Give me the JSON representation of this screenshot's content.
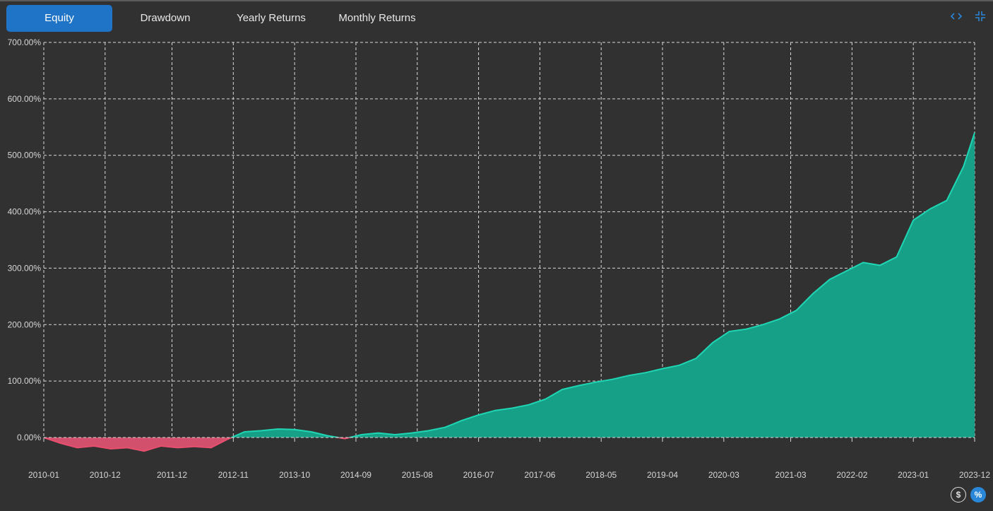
{
  "tabs": [
    {
      "label": "Equity",
      "active": true
    },
    {
      "label": "Drawdown",
      "active": false
    },
    {
      "label": "Yearly Returns",
      "active": false
    },
    {
      "label": "Monthly Returns",
      "active": false
    }
  ],
  "controls": {
    "expand_icon": "code-brackets-icon",
    "collapse_icon": "minimize-icon",
    "dollar_label": "$",
    "percent_label": "%",
    "active_unit": "percent"
  },
  "colors": {
    "background": "#313131",
    "positive": "#17a088",
    "positive_line": "#1fd6b4",
    "negative": "#d2506b",
    "negative_line": "#e84f6f",
    "accent": "#1f74c8",
    "grid": "#d9d9d9"
  },
  "chart_data": {
    "type": "area",
    "title": "",
    "xlabel": "",
    "ylabel": "",
    "grid": true,
    "ylim": [
      -50,
      700
    ],
    "y_ticks": [
      "0.00%",
      "100.00%",
      "200.00%",
      "300.00%",
      "400.00%",
      "500.00%",
      "600.00%",
      "700.00%"
    ],
    "x_ticks": [
      "2010-01",
      "2010-12",
      "2011-12",
      "2012-11",
      "2013-10",
      "2014-09",
      "2015-08",
      "2016-07",
      "2017-06",
      "2018-05",
      "2019-04",
      "2020-03",
      "2021-03",
      "2022-02",
      "2023-01",
      "2023-12"
    ],
    "series": [
      {
        "name": "",
        "x": [
          "2010-01",
          "2010-04",
          "2010-07",
          "2010-10",
          "2011-01",
          "2011-04",
          "2011-07",
          "2011-10",
          "2012-01",
          "2012-04",
          "2012-07",
          "2012-10",
          "2013-01",
          "2013-04",
          "2013-07",
          "2013-10",
          "2014-01",
          "2014-04",
          "2014-07",
          "2014-10",
          "2015-01",
          "2015-04",
          "2015-07",
          "2015-10",
          "2016-01",
          "2016-04",
          "2016-07",
          "2016-10",
          "2017-01",
          "2017-04",
          "2017-07",
          "2017-10",
          "2018-01",
          "2018-04",
          "2018-07",
          "2018-10",
          "2019-01",
          "2019-04",
          "2019-07",
          "2019-10",
          "2020-01",
          "2020-04",
          "2020-07",
          "2020-10",
          "2021-01",
          "2021-04",
          "2021-07",
          "2021-10",
          "2022-01",
          "2022-04",
          "2022-07",
          "2022-10",
          "2023-01",
          "2023-04",
          "2023-07",
          "2023-10",
          "2023-12"
        ],
        "values": [
          0,
          -10,
          -18,
          -15,
          -20,
          -18,
          -24,
          -15,
          -18,
          -16,
          -18,
          -3,
          10,
          12,
          15,
          14,
          10,
          3,
          -2,
          5,
          8,
          5,
          8,
          12,
          18,
          30,
          40,
          48,
          52,
          58,
          68,
          85,
          92,
          98,
          103,
          110,
          115,
          122,
          128,
          140,
          168,
          188,
          192,
          200,
          210,
          225,
          255,
          280,
          295,
          310,
          305,
          320,
          385,
          405,
          420,
          480,
          540
        ]
      }
    ]
  }
}
